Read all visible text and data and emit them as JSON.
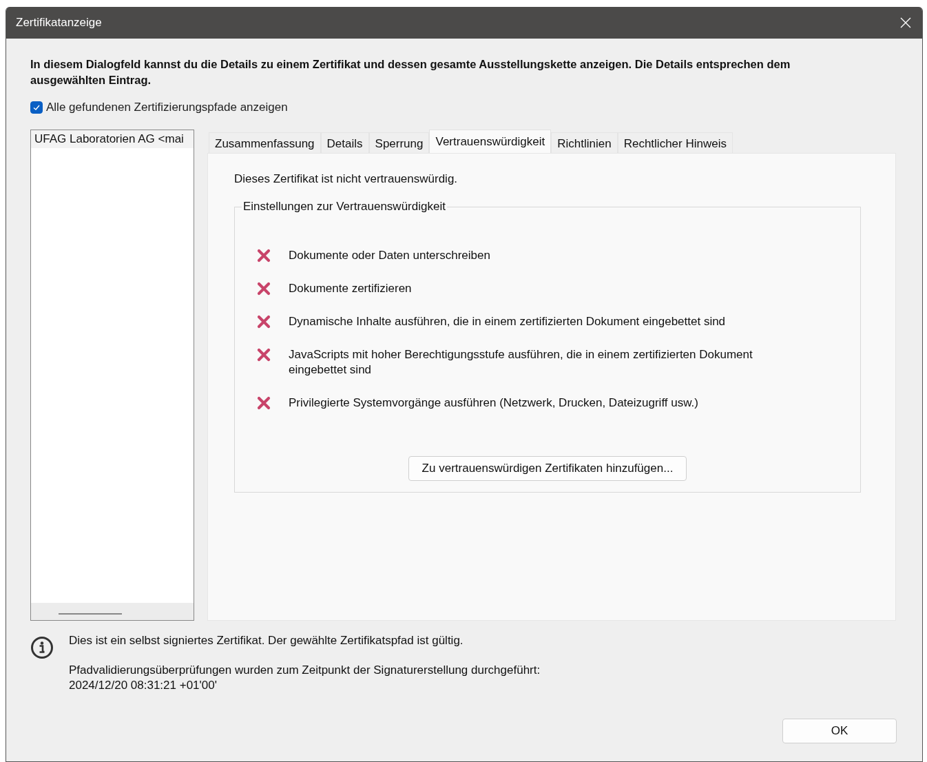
{
  "window": {
    "title": "Zertifikatanzeige"
  },
  "description": "In diesem Dialogfeld kannst du die Details zu einem Zertifikat und dessen gesamte Ausstellungskette anzeigen. Die Details entsprechen dem ausgewählten Eintrag.",
  "show_all_paths": {
    "label": "Alle gefundenen Zertifizierungspfade anzeigen",
    "checked": true
  },
  "certificate_list": [
    {
      "label": "UFAG Laboratorien AG <mai",
      "selected": true
    }
  ],
  "tabs": [
    {
      "label": "Zusammenfassung",
      "selected": false
    },
    {
      "label": "Details",
      "selected": false
    },
    {
      "label": "Sperrung",
      "selected": false
    },
    {
      "label": "Vertrauenswürdigkeit",
      "selected": true
    },
    {
      "label": "Richtlinien",
      "selected": false
    },
    {
      "label": "Rechtlicher Hinweis",
      "selected": false
    }
  ],
  "trust_status": "Dieses Zertifikat ist nicht vertrauenswürdig.",
  "trust_settings": {
    "title": "Einstellungen zur Vertrauenswürdigkeit",
    "items": [
      {
        "label": "Dokumente oder Daten unterschreiben",
        "allowed": false
      },
      {
        "label": "Dokumente zertifizieren",
        "allowed": false
      },
      {
        "label": "Dynamische Inhalte ausführen, die in einem zertifizierten Dokument eingebettet sind",
        "allowed": false
      },
      {
        "label": "JavaScripts mit hoher Berechtigungsstufe ausführen, die in einem zertifizierten Dokument eingebettet sind",
        "allowed": false
      },
      {
        "label": "Privilegierte Systemvorgänge ausführen (Netzwerk, Drucken, Dateizugriff usw.)",
        "allowed": false
      }
    ],
    "button": "Zu vertrauenswürdigen Zertifikaten hinzufügen..."
  },
  "info": [
    "Dies ist ein selbst signiertes Zertifikat. Der gewählte Zertifikatspfad ist gültig.",
    "Pfadvalidierungsüberprüfungen wurden zum Zeitpunkt der Signaturerstellung durchgeführt:\n2024/12/20 08:31:21 +01'00'"
  ],
  "buttons": [
    "OK"
  ]
}
